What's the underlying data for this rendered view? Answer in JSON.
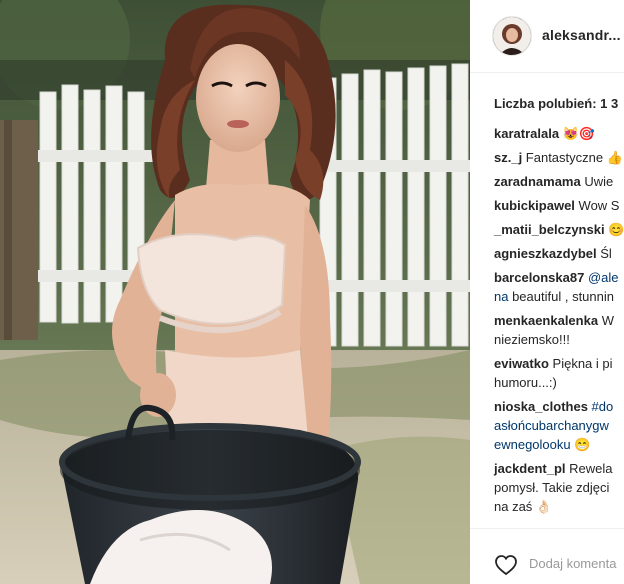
{
  "header": {
    "username": "aleksandr..."
  },
  "post": {
    "likes_label": "Liczba polubień: 1 3"
  },
  "comments": [
    {
      "user": "karatralala",
      "text": " 😻🎯"
    },
    {
      "user": "sz._j",
      "text": " Fantastyczne 👍"
    },
    {
      "user": "zaradnamama",
      "text": " Uwie"
    },
    {
      "user": "kubickipawel",
      "text": " Wow S"
    },
    {
      "user": "_matii_belczynski",
      "text": " 😊"
    },
    {
      "user": "agnieszkazdybel",
      "text": " Śl"
    },
    {
      "user": "barcelonska87",
      "text_blue": " @ale",
      "line2_blue": "na",
      "line2": " beautiful , stunnin"
    },
    {
      "user": "menkaenkalenka",
      "text": " W",
      "line2": "nieziemsko!!!"
    },
    {
      "user": "eviwatko",
      "text": " Piękna i pi",
      "line2": "humoru...:)"
    },
    {
      "user": "nioska_clothes",
      "text_blue": " #do",
      "line2_blue": "asłońcubarchanygw",
      "line3_blue": "ewnegolooku",
      "line4": "😁"
    },
    {
      "user": "jackdent_pl",
      "text": " Rewela",
      "line2": "pomysł. Takie zdjęci",
      "line3": "na zaś 👌🏻"
    }
  ],
  "footer": {
    "add_comment_placeholder": "Dodaj komenta",
    "like_icon": "heart-outline-icon"
  }
}
